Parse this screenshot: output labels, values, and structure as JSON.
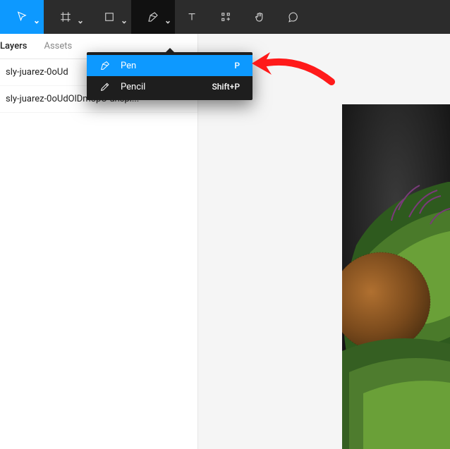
{
  "toolbar": {
    "tools": [
      {
        "name": "move",
        "active": true,
        "has_chevron": true
      },
      {
        "name": "frame",
        "has_chevron": true
      },
      {
        "name": "shape",
        "has_chevron": true
      },
      {
        "name": "pen",
        "has_chevron": true,
        "open": true
      },
      {
        "name": "text"
      },
      {
        "name": "resources"
      },
      {
        "name": "hand"
      },
      {
        "name": "comment"
      }
    ]
  },
  "sidebar": {
    "tabs": [
      {
        "label": "Layers",
        "active": true
      },
      {
        "label": "Assets",
        "active": false
      }
    ],
    "layers": [
      {
        "label": "sly-juarez-0oUd"
      },
      {
        "label": "sly-juarez-0oUdOlDm8pU-unspl..."
      }
    ]
  },
  "dropdown": {
    "items": [
      {
        "icon": "pen",
        "label": "Pen",
        "shortcut": "P",
        "highlight": true
      },
      {
        "icon": "pencil",
        "label": "Pencil",
        "shortcut": "Shift+P",
        "highlight": false
      }
    ]
  }
}
